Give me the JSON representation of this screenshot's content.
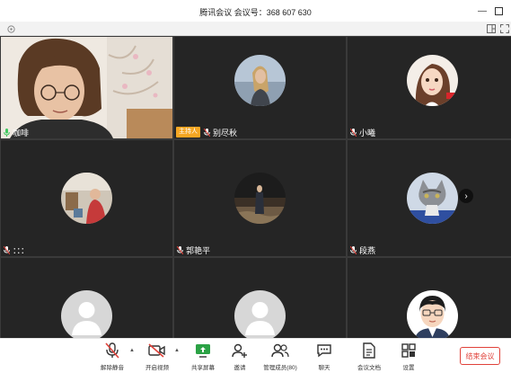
{
  "window": {
    "title": "腾讯会议  会议号：368 607 630"
  },
  "participants": [
    {
      "name": "咖啡",
      "type": "video",
      "host": false
    },
    {
      "name": "别尽秋",
      "type": "avatar",
      "host": true,
      "host_label": "主持人"
    },
    {
      "name": "小曦",
      "type": "avatar",
      "host": false
    },
    {
      "name": "：：：",
      "type": "avatar",
      "host": false
    },
    {
      "name": "郭艳平",
      "type": "avatar",
      "host": false
    },
    {
      "name": "段燕",
      "type": "avatar",
      "host": false
    },
    {
      "name": "",
      "type": "placeholder",
      "host": false
    },
    {
      "name": "",
      "type": "placeholder",
      "host": false
    },
    {
      "name": "",
      "type": "avatar",
      "host": false
    }
  ],
  "toolbar": {
    "mute_label": "解除静音",
    "video_label": "开启视频",
    "share_label": "共享屏幕",
    "invite_label": "邀请",
    "members_label": "管理成员(80)",
    "chat_label": "聊天",
    "docs_label": "会议文档",
    "settings_label": "设置",
    "end_label": "结束会议"
  },
  "colors": {
    "host_badge": "#f5a623",
    "end_button": "#e0423a",
    "share_icon": "#2ba245",
    "tile_bg": "#252525"
  }
}
